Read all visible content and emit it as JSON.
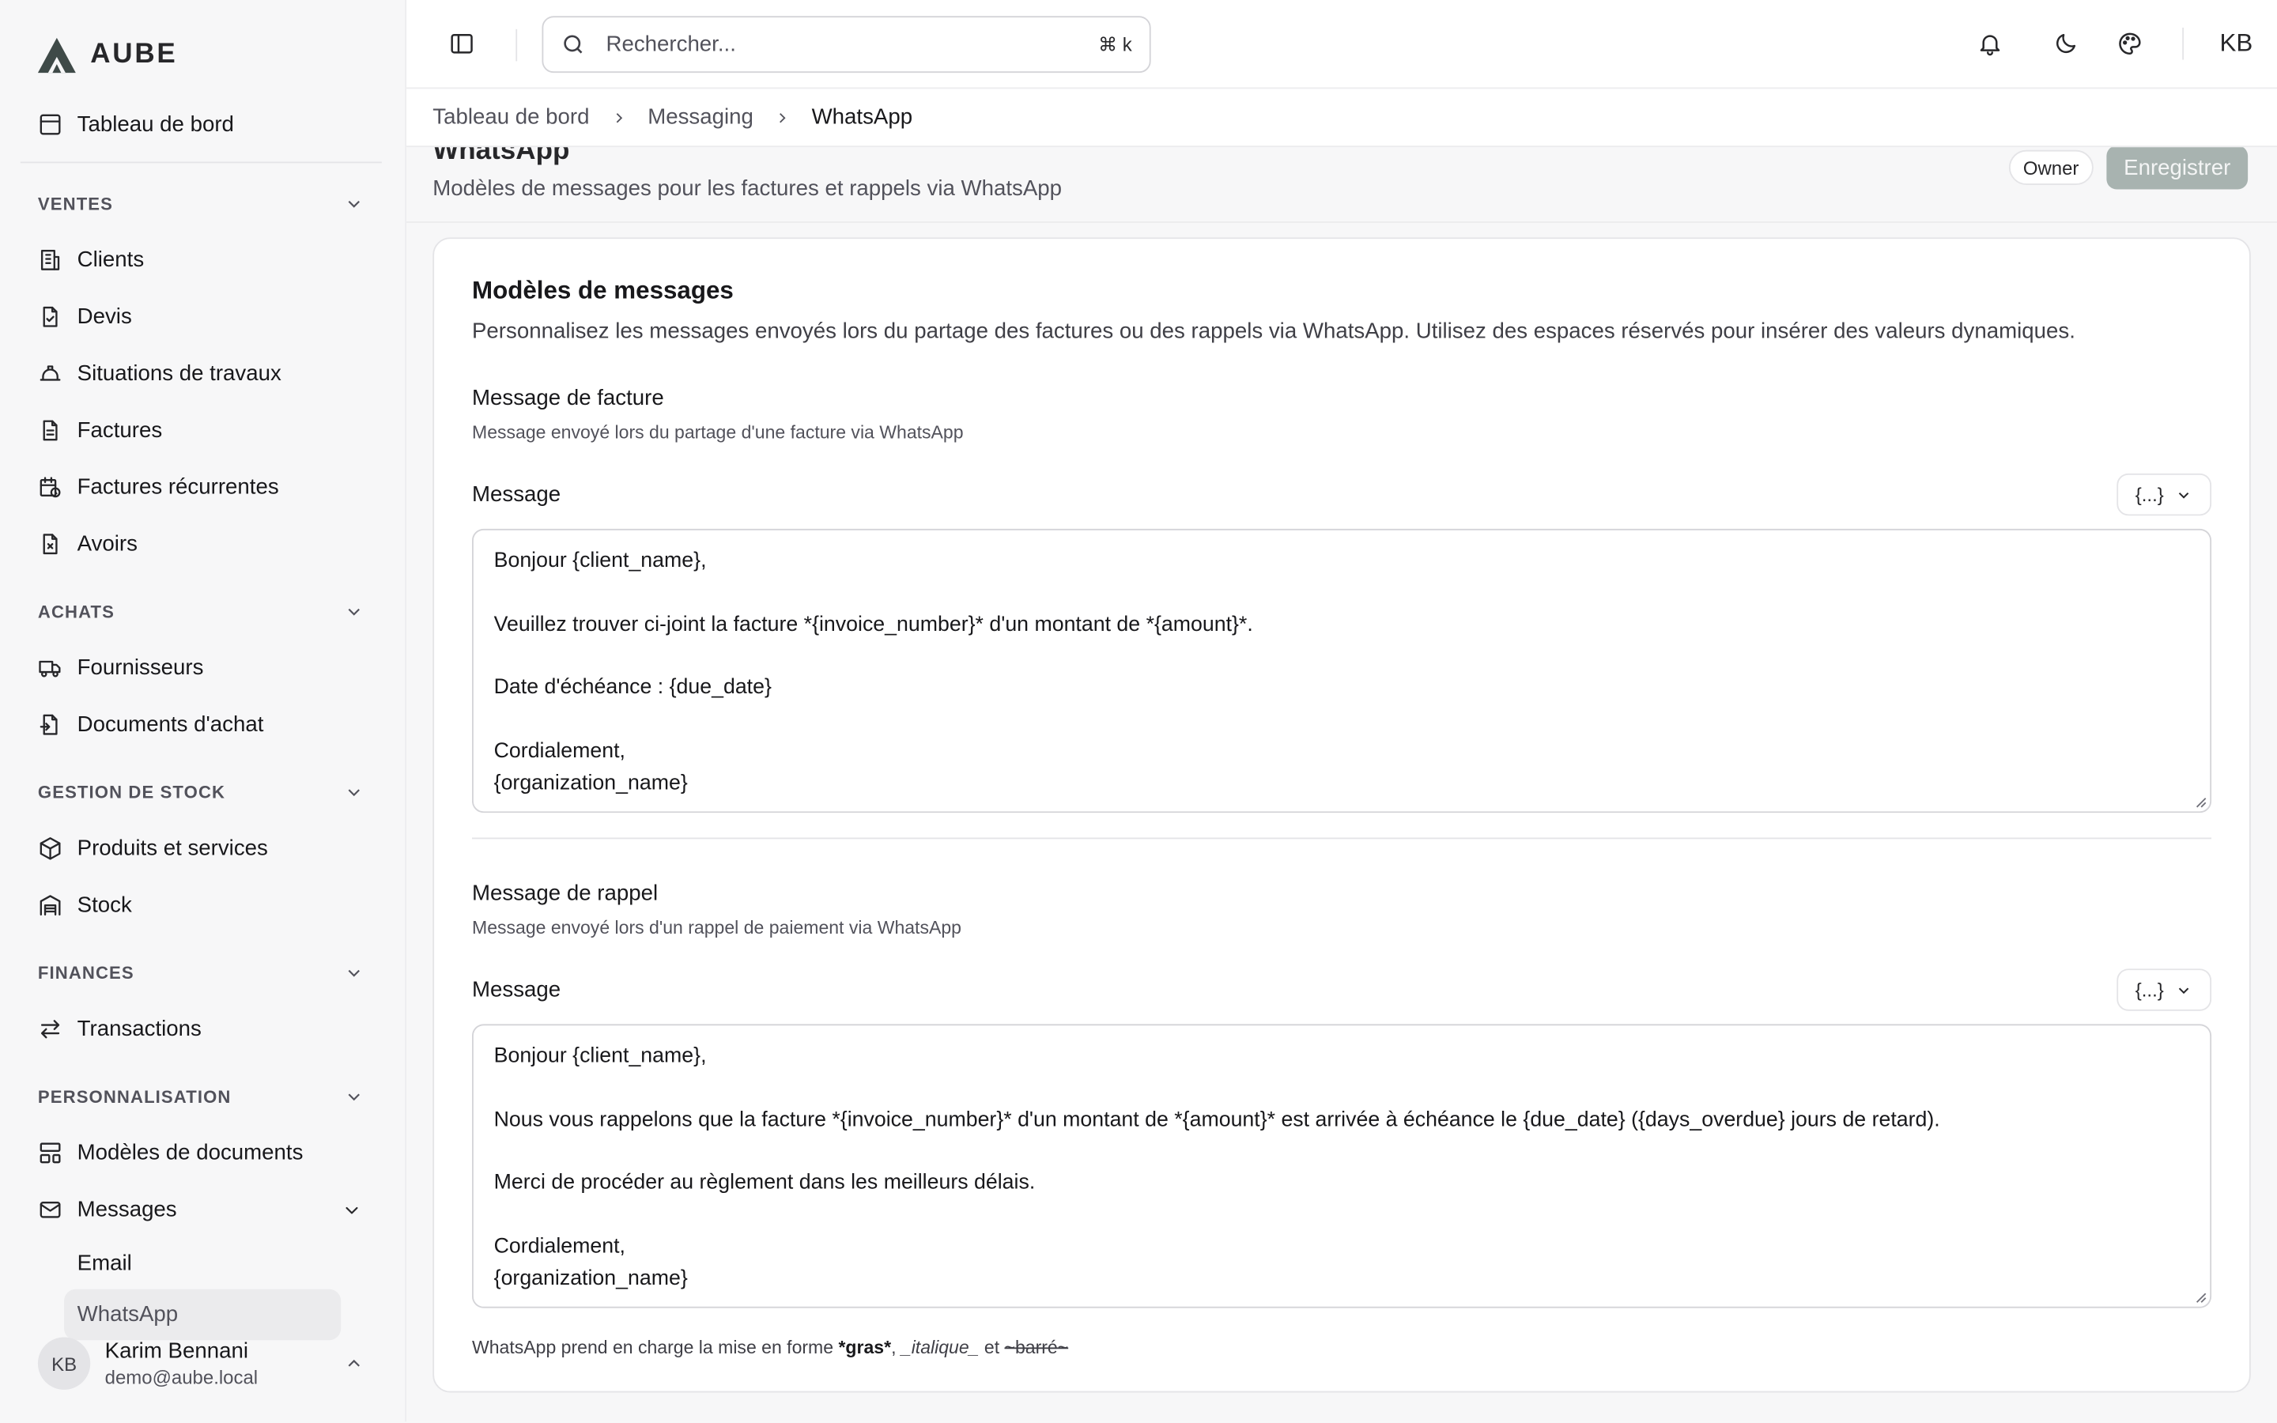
{
  "app": {
    "logo_text": "AUBE"
  },
  "sidebar": {
    "top_item": "Tableau de bord",
    "sections": [
      {
        "title": "VENTES",
        "items": [
          "Clients",
          "Devis",
          "Situations de travaux",
          "Factures",
          "Factures récurrentes",
          "Avoirs"
        ]
      },
      {
        "title": "ACHATS",
        "items": [
          "Fournisseurs",
          "Documents d'achat"
        ]
      },
      {
        "title": "GESTION DE STOCK",
        "items": [
          "Produits et services",
          "Stock"
        ]
      },
      {
        "title": "FINANCES",
        "items": [
          "Transactions"
        ]
      },
      {
        "title": "PERSONNALISATION",
        "items": [
          "Modèles de documents",
          "Messages"
        ]
      }
    ],
    "messages_sub": [
      "Email",
      "WhatsApp"
    ],
    "user": {
      "initials": "KB",
      "name": "Karim Bennani",
      "email": "demo@aube.local"
    }
  },
  "topbar": {
    "search_placeholder": "Rechercher...",
    "shortcut": "⌘ k",
    "user_initials": "KB"
  },
  "breadcrumb": [
    "Tableau de bord",
    "Messaging",
    "WhatsApp"
  ],
  "page": {
    "title": "WhatsApp",
    "subtitle": "Modèles de messages pour les factures et rappels via WhatsApp",
    "owner_badge": "Owner",
    "save_label": "Enregistrer"
  },
  "card": {
    "title": "Modèles de messages",
    "description": "Personnalisez les messages envoyés lors du partage des factures ou des rappels via WhatsApp. Utilisez des espaces réservés pour insérer des valeurs dynamiques.",
    "invoice": {
      "title": "Message de facture",
      "hint": "Message envoyé lors du partage d'une facture via WhatsApp",
      "label": "Message",
      "var_button": "{...}",
      "text": "Bonjour {client_name},\n\nVeuillez trouver ci-joint la facture *{invoice_number}* d'un montant de *{amount}*.\n\nDate d'échéance : {due_date}\n\nCordialement,\n{organization_name}"
    },
    "reminder": {
      "title": "Message de rappel",
      "hint": "Message envoyé lors d'un rappel de paiement via WhatsApp",
      "label": "Message",
      "var_button": "{...}",
      "text": "Bonjour {client_name},\n\nNous vous rappelons que la facture *{invoice_number}* d'un montant de *{amount}* est arrivée à échéance le {due_date} ({days_overdue} jours de retard).\n\nMerci de procéder au règlement dans les meilleurs délais.\n\nCordialement,\n{organization_name}"
    },
    "footnote": {
      "prefix": "WhatsApp prend en charge la mise en forme ",
      "bold": "*gras*",
      "sep1": ", ",
      "italic": "_italique_",
      "sep2": " et ",
      "strike": "~barré~"
    }
  }
}
